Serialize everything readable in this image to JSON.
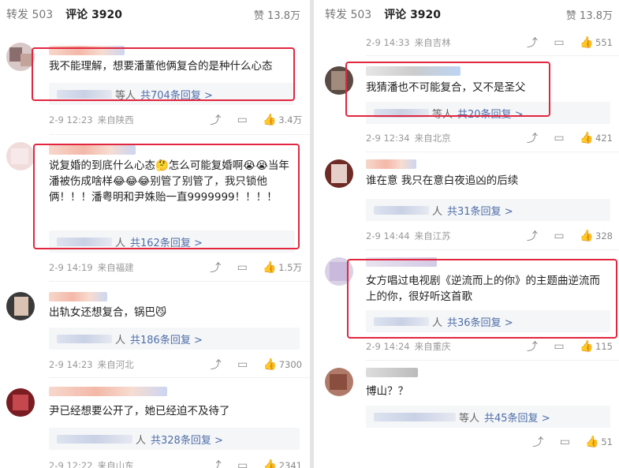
{
  "tabs": {
    "repost_label": "转发",
    "repost_count": "503",
    "comment_label": "评论",
    "comment_count": "3920",
    "likes_label": "赞",
    "likes_count": "13.8万"
  },
  "left": {
    "comments": [
      {
        "text": "我不能理解，想要潘董他俩复合的是种什么心态",
        "reply_suffix": "等人",
        "reply_count": "共704条回复 >",
        "date": "2-9 12:23",
        "location": "来自陕西",
        "likes": "3.4万"
      },
      {
        "text": "说复婚的到底什么心态🤔怎么可能复婚啊😭😭当年潘被伤成啥样😂😂😂别管了别管了，我只锁他俩！！！潘粤明和尹姝贻一直9999999！！！！",
        "reply_suffix": "人",
        "reply_count": "共162条回复 >",
        "date": "2-9 14:19",
        "location": "来自福建",
        "likes": "1.5万"
      },
      {
        "text": "出轨女还想复合，锅巴😼",
        "reply_suffix": "人",
        "reply_count": "共186条回复 >",
        "date": "2-9 14:23",
        "location": "来自河北",
        "likes": "7300"
      },
      {
        "text": "尹已经想要公开了，她已经迫不及待了",
        "reply_suffix": "人",
        "reply_count": "共328条回复 >",
        "date": "2-9 12:22",
        "location": "来自山东",
        "likes": "2341"
      }
    ]
  },
  "right": {
    "top_meta": {
      "date": "2-9 14:33",
      "location": "来自吉林",
      "likes": "551"
    },
    "comments": [
      {
        "text": "我猜潘也不可能复合，又不是圣父",
        "reply_suffix": "等人",
        "reply_count": "共20条回复 >",
        "date": "2-9 12:34",
        "location": "来自北京",
        "likes": "421"
      },
      {
        "text": "谁在意 我只在意白夜追凶的后续",
        "reply_suffix": "人",
        "reply_count": "共31条回复 >",
        "date": "2-9 14:44",
        "location": "来自江苏",
        "likes": "328"
      },
      {
        "text": "女方唱过电视剧《逆流而上的你》的主题曲逆流而上的你，很好听这首歌",
        "reply_suffix": "人",
        "reply_count": "共36条回复 >",
        "date": "2-9 14:24",
        "location": "来自重庆",
        "likes": "115"
      },
      {
        "text": "博山？？",
        "reply_suffix": "等人",
        "reply_count": "共45条回复 >",
        "date": "",
        "location": "",
        "likes": "51"
      }
    ]
  },
  "colors": {
    "highlight": "#e2263f",
    "link": "#4e6ea8",
    "reply_bg": "#f5f6f8",
    "meta": "#999999"
  },
  "icons": {
    "repost": "repost-icon",
    "comment": "comment-icon",
    "like": "thumbs-up-icon"
  }
}
